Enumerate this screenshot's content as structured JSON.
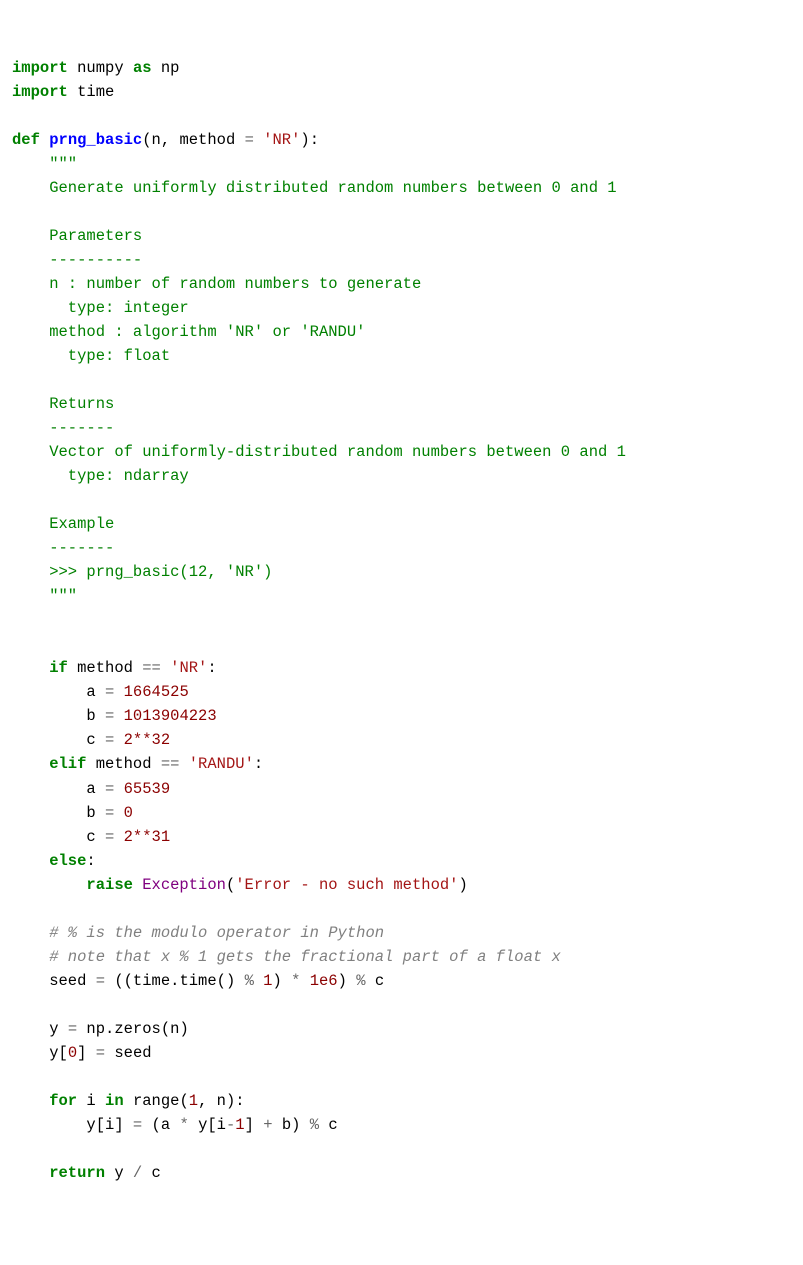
{
  "code": {
    "l01_import": "import",
    "l01_numpy": "numpy",
    "l01_as": "as",
    "l01_np": "np",
    "l02_import": "import",
    "l02_time": "time",
    "l04_def": "def",
    "l04_fn": "prng_basic",
    "l04_sig_open": "(n, method ",
    "l04_eq": "=",
    "l04_default": " 'NR'",
    "l04_sig_close": "):",
    "l05_tq": "    \"\"\"",
    "l06": "    Generate uniformly distributed random numbers between 0 and 1",
    "l08": "    Parameters",
    "l09": "    ----------",
    "l10": "    n : number of random numbers to generate",
    "l11": "      type: integer",
    "l12": "    method : algorithm 'NR' or 'RANDU'",
    "l13": "      type: float",
    "l15": "    Returns",
    "l16": "    -------",
    "l17": "    Vector of uniformly-distributed random numbers between 0 and 1",
    "l18": "      type: ndarray",
    "l20": "    Example",
    "l21": "    -------",
    "l22": "    >>> prng_basic(12, 'NR')",
    "l23_tq": "    \"\"\"",
    "l26_if": "    if",
    "l26_cond": " method ",
    "l26_op": "==",
    "l26_str": " 'NR'",
    "l26_colon": ":",
    "l27_a": "        a ",
    "l27_eq": "=",
    "l27_val": " 1664525",
    "l28_b": "        b ",
    "l28_eq": "=",
    "l28_val": " 1013904223",
    "l29_c": "        c ",
    "l29_eq": "=",
    "l29_val": " 2**32",
    "l30_elif": "    elif",
    "l30_cond": " method ",
    "l30_op": "==",
    "l30_str": " 'RANDU'",
    "l30_colon": ":",
    "l31_a": "        a ",
    "l31_eq": "=",
    "l31_val": " 65539",
    "l32_b": "        b ",
    "l32_eq": "=",
    "l32_val": " 0",
    "l33_c": "        c ",
    "l33_eq": "=",
    "l33_val": " 2**31",
    "l34_else": "    else",
    "l34_colon": ":",
    "l35_raise": "        raise",
    "l35_exc": " Exception",
    "l35_open": "(",
    "l35_msg": "'Error - no such method'",
    "l35_close": ")",
    "l37": "    # % is the modulo operator in Python",
    "l38": "    # note that x % 1 gets the fractional part of a float x",
    "l39_seed": "    seed ",
    "l39_eq": "=",
    "l39_expr1": " ((time.time() ",
    "l39_mod1": "%",
    "l39_one": " 1",
    "l39_expr2": ") ",
    "l39_mul": "*",
    "l39_mill": " 1e6",
    "l39_expr3": ") ",
    "l39_mod2": "%",
    "l39_c": " c",
    "l41_y": "    y ",
    "l41_eq": "=",
    "l41_np": " np.zeros(n)",
    "l42_y0": "    y[",
    "l42_zero": "0",
    "l42_close": "] ",
    "l42_eq": "=",
    "l42_seed": " seed",
    "l44_for": "    for",
    "l44_i": " i ",
    "l44_in": "in",
    "l44_range": " range(",
    "l44_one": "1",
    "l44_comma": ", n):",
    "l45_yi": "        y[i] ",
    "l45_eq": "=",
    "l45_open": " (a ",
    "l45_mul": "*",
    "l45_yim1": " y[i",
    "l45_minus": "-",
    "l45_one": "1",
    "l45_close": "] ",
    "l45_plus": "+",
    "l45_b": " b) ",
    "l45_mod": "%",
    "l45_c": " c",
    "l47_ret": "    return",
    "l47_expr": " y ",
    "l47_div": "/",
    "l47_c": " c"
  }
}
